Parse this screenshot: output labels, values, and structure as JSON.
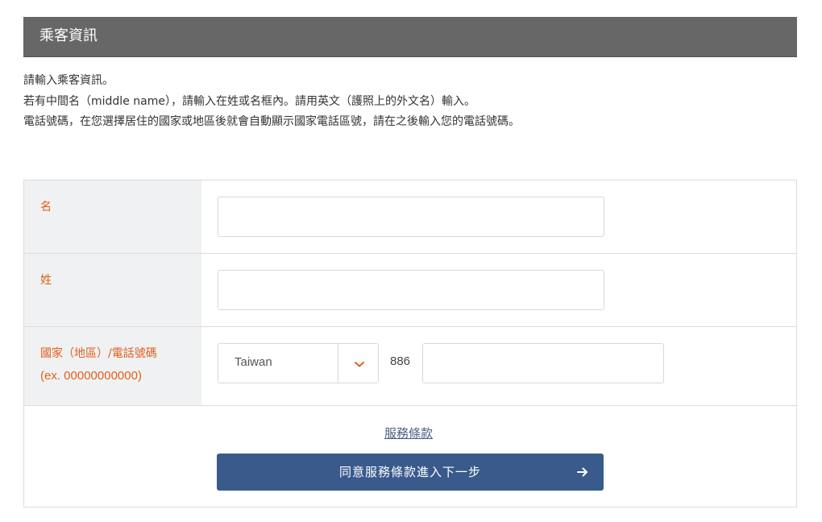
{
  "header": {
    "title": "乘客資訊"
  },
  "intro": {
    "line1": "請輸入乘客資訊。",
    "line2": "若有中間名（middle name），請輸入在姓或名框內。請用英文（護照上的外文名）輸入。",
    "line3": "電話號碼，在您選擇居住的國家或地區後就會自動顯示國家電話區號，請在之後輸入您的電話號碼。"
  },
  "form": {
    "first_name": {
      "label": "名",
      "value": "",
      "placeholder": ""
    },
    "last_name": {
      "label": "姓",
      "value": "",
      "placeholder": ""
    },
    "phone": {
      "label_line1": "國家（地區）/電話號碼",
      "label_line2": "(ex. 00000000000)",
      "country_selected": "Taiwan",
      "dial_code": "886",
      "value": "",
      "placeholder": ""
    }
  },
  "footer": {
    "terms_link": "服務條款",
    "submit_label": "同意服務條款進入下一步"
  },
  "icons": {
    "chevron": "chevron-down-icon",
    "arrow": "arrow-right-icon"
  },
  "colors": {
    "header_bg": "#666766",
    "label_accent": "#e0601c",
    "button_bg": "#3a5a8c",
    "label_cell_bg": "#f0f1f2",
    "link": "#4a5f85"
  }
}
